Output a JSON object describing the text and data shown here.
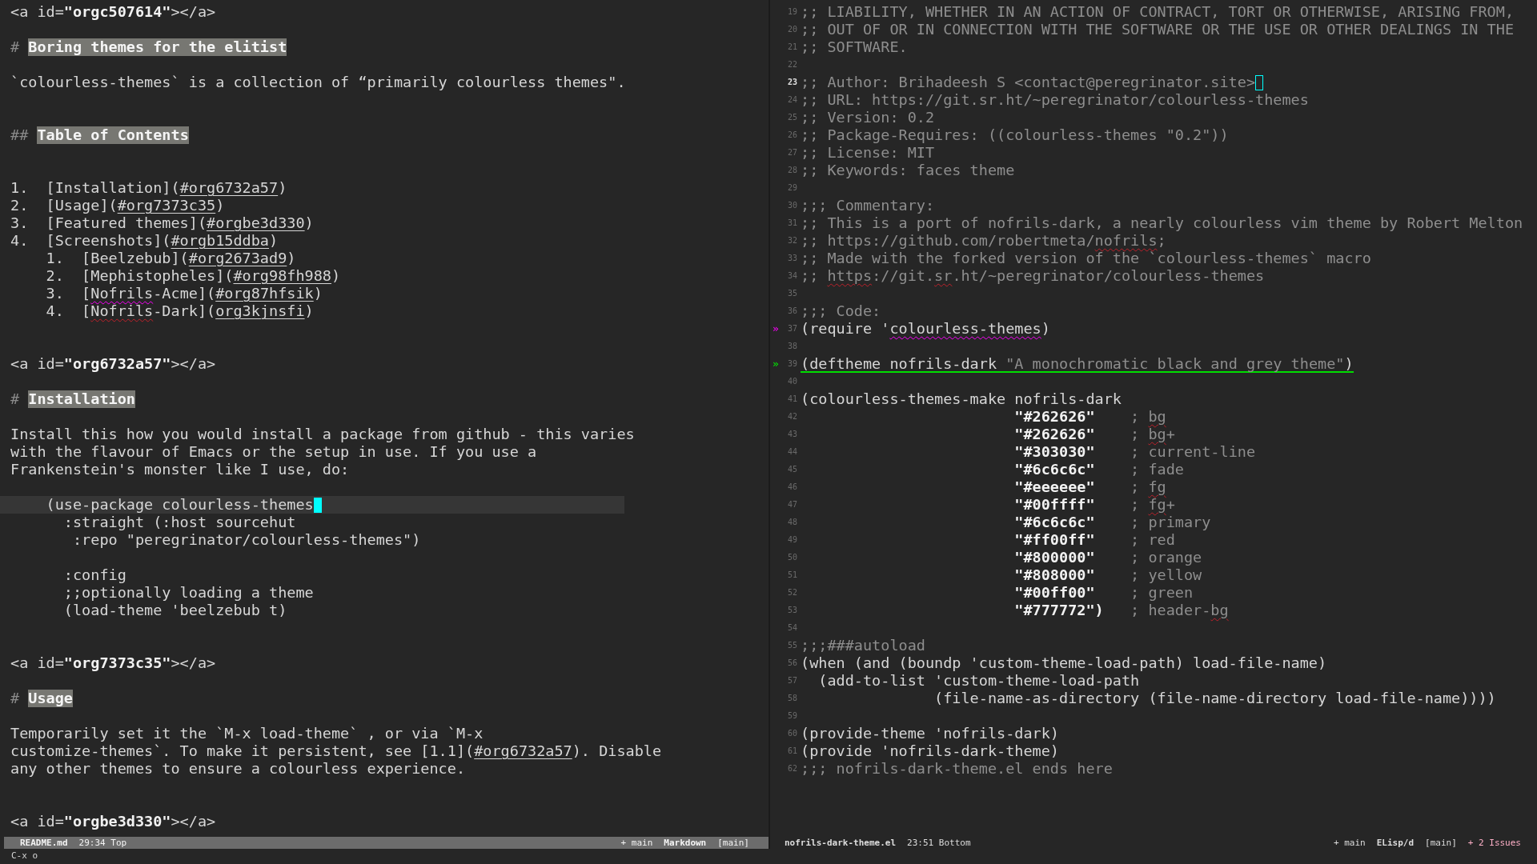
{
  "left": {
    "lines": [
      {
        "current": false,
        "segs": [
          {
            "text": "<a id=",
            "kind": "plain"
          },
          {
            "text": "\"orgc507614\"",
            "kind": "bold"
          },
          {
            "text": "></a>",
            "kind": "plain"
          }
        ]
      },
      {
        "current": false
      },
      {
        "current": false,
        "segs": [
          {
            "text": "# ",
            "kind": "mark"
          },
          {
            "text": "Boring themes for the elitist",
            "kind": "heading"
          }
        ]
      },
      {
        "current": false
      },
      {
        "current": false,
        "segs": [
          {
            "text": "`colourless-themes` is a collection of “primarily colourless themes\".",
            "kind": "plain"
          }
        ]
      },
      {
        "current": false
      },
      {
        "current": false
      },
      {
        "current": false,
        "segs": [
          {
            "text": "## ",
            "kind": "mark"
          },
          {
            "text": "Table of Contents",
            "kind": "heading"
          }
        ]
      },
      {
        "current": false
      },
      {
        "current": false
      },
      {
        "current": false,
        "segs": [
          {
            "text": "1.  [Installation](",
            "kind": "plain"
          },
          {
            "text": "#org6732a57",
            "kind": "link"
          },
          {
            "text": ")",
            "kind": "plain"
          }
        ]
      },
      {
        "current": false,
        "segs": [
          {
            "text": "2.  [Usage](",
            "kind": "plain"
          },
          {
            "text": "#org7373c35",
            "kind": "link"
          },
          {
            "text": ")",
            "kind": "plain"
          }
        ]
      },
      {
        "current": false,
        "segs": [
          {
            "text": "3.  [Featured themes](",
            "kind": "plain"
          },
          {
            "text": "#orgbe3d330",
            "kind": "link"
          },
          {
            "text": ")",
            "kind": "plain"
          }
        ]
      },
      {
        "current": false,
        "segs": [
          {
            "text": "4.  [Screenshots](",
            "kind": "plain"
          },
          {
            "text": "#orgb15ddba",
            "kind": "link"
          },
          {
            "text": ")",
            "kind": "plain"
          }
        ]
      },
      {
        "current": false,
        "segs": [
          {
            "text": "    1.  [Beelzebub](",
            "kind": "plain"
          },
          {
            "text": "#org2673ad9",
            "kind": "link"
          },
          {
            "text": ")",
            "kind": "plain"
          }
        ]
      },
      {
        "current": false,
        "segs": [
          {
            "text": "    2.  [Mephistopheles](",
            "kind": "plain"
          },
          {
            "text": "#org98fh988",
            "kind": "link"
          },
          {
            "text": ")",
            "kind": "plain"
          }
        ]
      },
      {
        "current": false,
        "segs": [
          {
            "text": "    3.  [",
            "kind": "plain"
          },
          {
            "text": "Nofrils",
            "kind": "plain",
            "flagged": true
          },
          {
            "text": "-Acme](",
            "kind": "plain"
          },
          {
            "text": "#org87hfsik",
            "kind": "link"
          },
          {
            "text": ")",
            "kind": "plain"
          }
        ]
      },
      {
        "current": false,
        "segs": [
          {
            "text": "    4.  [",
            "kind": "plain"
          },
          {
            "text": "Nofrils",
            "kind": "plain",
            "misspelled": true
          },
          {
            "text": "-Dark](",
            "kind": "plain"
          },
          {
            "text": "org3kjnsfi",
            "kind": "link"
          },
          {
            "text": ")",
            "kind": "plain"
          }
        ]
      },
      {
        "current": false
      },
      {
        "current": false
      },
      {
        "current": false,
        "segs": [
          {
            "text": "<a id=",
            "kind": "plain"
          },
          {
            "text": "\"org6732a57\"",
            "kind": "bold"
          },
          {
            "text": "></a>",
            "kind": "plain"
          }
        ]
      },
      {
        "current": false
      },
      {
        "current": false,
        "segs": [
          {
            "text": "# ",
            "kind": "mark"
          },
          {
            "text": "Installation",
            "kind": "heading"
          }
        ]
      },
      {
        "current": false
      },
      {
        "current": false,
        "segs": [
          {
            "text": "Install this how you would install a package from github - this varies",
            "kind": "plain"
          }
        ]
      },
      {
        "current": false,
        "segs": [
          {
            "text": "with the flavour of Emacs or the setup in use. If you use a",
            "kind": "plain"
          }
        ]
      },
      {
        "current": false,
        "segs": [
          {
            "text": "Frankenstein's monster like I use, do:",
            "kind": "plain"
          }
        ]
      },
      {
        "current": false
      },
      {
        "current": true,
        "cursor": true,
        "segs": [
          {
            "text": "    (use-package colourless-themes",
            "kind": "plain"
          }
        ]
      },
      {
        "current": false,
        "segs": [
          {
            "text": "      :straight (:host sourcehut",
            "kind": "plain"
          }
        ]
      },
      {
        "current": false,
        "segs": [
          {
            "text": "       :repo \"peregrinator/colourless-themes\")",
            "kind": "plain"
          }
        ]
      },
      {
        "current": false
      },
      {
        "current": false,
        "segs": [
          {
            "text": "      :config",
            "kind": "plain"
          }
        ]
      },
      {
        "current": false,
        "segs": [
          {
            "text": "      ;;optionally loading a theme",
            "kind": "plain"
          }
        ]
      },
      {
        "current": false,
        "segs": [
          {
            "text": "      (load-theme 'beelzebub t)",
            "kind": "plain"
          }
        ]
      },
      {
        "current": false
      },
      {
        "current": false
      },
      {
        "current": false,
        "segs": [
          {
            "text": "<a id=",
            "kind": "plain"
          },
          {
            "text": "\"org7373c35\"",
            "kind": "bold"
          },
          {
            "text": "></a>",
            "kind": "plain"
          }
        ]
      },
      {
        "current": false
      },
      {
        "current": false,
        "segs": [
          {
            "text": "# ",
            "kind": "mark"
          },
          {
            "text": "Usage",
            "kind": "heading"
          }
        ]
      },
      {
        "current": false
      },
      {
        "current": false,
        "segs": [
          {
            "text": "Temporarily set it the `M-x load-theme` , or via `M-x",
            "kind": "plain"
          }
        ]
      },
      {
        "current": false,
        "segs": [
          {
            "text": "customize-themes`. To make it persistent, see [1.1](",
            "kind": "plain"
          },
          {
            "text": "#org6732a57",
            "kind": "link"
          },
          {
            "text": "). Disable",
            "kind": "plain"
          }
        ]
      },
      {
        "current": false,
        "segs": [
          {
            "text": "any other themes to ensure a colourless experience.",
            "kind": "plain"
          }
        ]
      },
      {
        "current": false
      },
      {
        "current": false
      },
      {
        "current": false,
        "segs": [
          {
            "text": "<a id=",
            "kind": "plain"
          },
          {
            "text": "\"orgbe3d330\"",
            "kind": "bold"
          },
          {
            "text": "></a>",
            "kind": "plain"
          }
        ]
      }
    ],
    "mode_line": {
      "active": true,
      "left": [
        {
          "text": "README.md",
          "kind": "bold"
        },
        {
          "text": "29:34 Top",
          "kind": "plain"
        }
      ],
      "right": [
        {
          "text": "+ main",
          "kind": "plain"
        },
        {
          "text": "Markdown",
          "kind": "bold"
        },
        {
          "text": "[main]",
          "kind": "plain"
        }
      ]
    }
  },
  "right": {
    "lines": [
      {
        "number": "19",
        "current": false,
        "segs": [
          {
            "text": ";; LIABILITY, WHETHER IN AN ACTION OF CONTRACT, TORT OR OTHERWISE, ARISING FROM,",
            "kind": "comment"
          }
        ]
      },
      {
        "number": "20",
        "current": false,
        "segs": [
          {
            "text": ";; OUT OF OR IN CONNECTION WITH THE SOFTWARE OR THE USE OR OTHER DEALINGS IN THE",
            "kind": "comment"
          }
        ]
      },
      {
        "number": "21",
        "current": false,
        "segs": [
          {
            "text": ";; SOFTWARE.",
            "kind": "comment"
          }
        ]
      },
      {
        "number": "22",
        "current": false
      },
      {
        "number": "23",
        "current": true,
        "cursor": true,
        "segs": [
          {
            "text": ";; Author: Brihadeesh S <contact@peregrinator.site>",
            "kind": "comment"
          }
        ]
      },
      {
        "number": "24",
        "current": false,
        "segs": [
          {
            "text": ";; URL: https://git.sr.ht/~peregrinator/colourless-themes",
            "kind": "comment"
          }
        ]
      },
      {
        "number": "25",
        "current": false,
        "segs": [
          {
            "text": ";; Version: 0.2",
            "kind": "comment"
          }
        ]
      },
      {
        "number": "26",
        "current": false,
        "segs": [
          {
            "text": ";; Package-Requires: ((colourless-themes \"0.2\"))",
            "kind": "comment"
          }
        ]
      },
      {
        "number": "27",
        "current": false,
        "segs": [
          {
            "text": ";; License: MIT",
            "kind": "comment"
          }
        ]
      },
      {
        "number": "28",
        "current": false,
        "segs": [
          {
            "text": ";; Keywords: faces theme",
            "kind": "comment"
          }
        ]
      },
      {
        "number": "29",
        "current": false
      },
      {
        "number": "30",
        "current": false,
        "segs": [
          {
            "text": ";;; Commentary:",
            "kind": "comment"
          }
        ]
      },
      {
        "number": "31",
        "current": false,
        "segs": [
          {
            "text": ";; This is a port of nofrils-dark, a nearly colourless vim theme by Robert Melton",
            "kind": "comment"
          }
        ]
      },
      {
        "number": "32",
        "current": false,
        "segs": [
          {
            "text": ";; https://github.com/robertmeta/",
            "kind": "comment"
          },
          {
            "text": "nofrils",
            "kind": "comment",
            "misspelled": true
          },
          {
            "text": ";",
            "kind": "comment"
          }
        ]
      },
      {
        "number": "33",
        "current": false,
        "segs": [
          {
            "text": ";; Made with the forked version of the `colourless-themes` macro",
            "kind": "comment"
          }
        ]
      },
      {
        "number": "34",
        "current": false,
        "segs": [
          {
            "text": ";; ",
            "kind": "comment"
          },
          {
            "text": "https",
            "kind": "comment",
            "misspelled": true
          },
          {
            "text": "://git.",
            "kind": "comment"
          },
          {
            "text": "sr",
            "kind": "comment",
            "misspelled": true
          },
          {
            "text": ".ht/~peregrinator/colourless-themes",
            "kind": "comment"
          }
        ]
      },
      {
        "number": "35",
        "current": false
      },
      {
        "number": "36",
        "current": false,
        "segs": [
          {
            "text": ";;; Code:",
            "kind": "comment"
          }
        ]
      },
      {
        "number": "37",
        "current": false,
        "fringe": {
          "text": "»",
          "kind": "warn"
        },
        "segs": [
          {
            "text": "(require '",
            "kind": "plain"
          },
          {
            "text": "colourless-themes",
            "kind": "plain",
            "flagged": true
          },
          {
            "text": ")",
            "kind": "plain"
          }
        ]
      },
      {
        "number": "38",
        "current": false
      },
      {
        "number": "39",
        "current": false,
        "fringe": {
          "text": "»",
          "kind": "ok"
        },
        "checked_ok": true,
        "segs": [
          {
            "text": "(deftheme nofrils-dark ",
            "kind": "plain"
          },
          {
            "text": "\"A monochromatic black and grey theme\"",
            "kind": "comment"
          },
          {
            "text": ")",
            "kind": "plain"
          }
        ]
      },
      {
        "number": "40",
        "current": false
      },
      {
        "number": "41",
        "current": false,
        "segs": [
          {
            "text": "(colourless-themes-make nofrils-dark",
            "kind": "plain"
          }
        ]
      },
      {
        "number": "42",
        "current": false,
        "segs": [
          {
            "text": "                        \"#262626\"    ",
            "kind": "bold"
          },
          {
            "text": "; ",
            "kind": "comment"
          },
          {
            "text": "bg",
            "kind": "comment",
            "misspelled": true
          }
        ]
      },
      {
        "number": "43",
        "current": false,
        "segs": [
          {
            "text": "                        \"#262626\"    ",
            "kind": "bold"
          },
          {
            "text": "; ",
            "kind": "comment"
          },
          {
            "text": "bg",
            "kind": "comment",
            "misspelled": true
          },
          {
            "text": "+",
            "kind": "comment"
          }
        ]
      },
      {
        "number": "44",
        "current": false,
        "segs": [
          {
            "text": "                        \"#303030\"    ",
            "kind": "bold"
          },
          {
            "text": "; current-line",
            "kind": "comment"
          }
        ]
      },
      {
        "number": "45",
        "current": false,
        "segs": [
          {
            "text": "                        \"#6c6c6c\"    ",
            "kind": "bold"
          },
          {
            "text": "; fade",
            "kind": "comment"
          }
        ]
      },
      {
        "number": "46",
        "current": false,
        "segs": [
          {
            "text": "                        \"#eeeeee\"    ",
            "kind": "bold"
          },
          {
            "text": "; ",
            "kind": "comment"
          },
          {
            "text": "fg",
            "kind": "comment",
            "misspelled": true
          }
        ]
      },
      {
        "number": "47",
        "current": false,
        "segs": [
          {
            "text": "                        \"#00ffff\"    ",
            "kind": "bold"
          },
          {
            "text": "; ",
            "kind": "comment"
          },
          {
            "text": "fg",
            "kind": "comment",
            "misspelled": true
          },
          {
            "text": "+",
            "kind": "comment"
          }
        ]
      },
      {
        "number": "48",
        "current": false,
        "segs": [
          {
            "text": "                        \"#6c6c6c\"    ",
            "kind": "bold"
          },
          {
            "text": "; primary",
            "kind": "comment"
          }
        ]
      },
      {
        "number": "49",
        "current": false,
        "segs": [
          {
            "text": "                        \"#ff00ff\"    ",
            "kind": "bold"
          },
          {
            "text": "; red",
            "kind": "comment"
          }
        ]
      },
      {
        "number": "50",
        "current": false,
        "segs": [
          {
            "text": "                        \"#800000\"    ",
            "kind": "bold"
          },
          {
            "text": "; orange",
            "kind": "comment"
          }
        ]
      },
      {
        "number": "51",
        "current": false,
        "segs": [
          {
            "text": "                        \"#808000\"    ",
            "kind": "bold"
          },
          {
            "text": "; yellow",
            "kind": "comment"
          }
        ]
      },
      {
        "number": "52",
        "current": false,
        "segs": [
          {
            "text": "                        \"#00ff00\"    ",
            "kind": "bold"
          },
          {
            "text": "; green",
            "kind": "comment"
          }
        ]
      },
      {
        "number": "53",
        "current": false,
        "segs": [
          {
            "text": "                        \"#777772\")   ",
            "kind": "bold"
          },
          {
            "text": "; header-",
            "kind": "comment"
          },
          {
            "text": "bg",
            "kind": "comment",
            "misspelled": true
          }
        ]
      },
      {
        "number": "54",
        "current": false
      },
      {
        "number": "55",
        "current": false,
        "segs": [
          {
            "text": ";;;###autoload",
            "kind": "comment"
          }
        ]
      },
      {
        "number": "56",
        "current": false,
        "segs": [
          {
            "text": "(when (and (boundp 'custom-theme-load-path) load-file-name)",
            "kind": "plain"
          }
        ]
      },
      {
        "number": "57",
        "current": false,
        "segs": [
          {
            "text": "  (add-to-list 'custom-theme-load-path",
            "kind": "plain"
          }
        ]
      },
      {
        "number": "58",
        "current": false,
        "segs": [
          {
            "text": "               (file-name-as-directory (file-name-directory load-file-name))))",
            "kind": "plain"
          }
        ]
      },
      {
        "number": "59",
        "current": false
      },
      {
        "number": "60",
        "current": false,
        "segs": [
          {
            "text": "(provide-theme 'nofrils-dark)",
            "kind": "plain"
          }
        ]
      },
      {
        "number": "61",
        "current": false,
        "segs": [
          {
            "text": "(provide 'nofrils-dark-theme)",
            "kind": "plain"
          }
        ]
      },
      {
        "number": "62",
        "current": false,
        "segs": [
          {
            "text": ";;; nofrils-dark-theme.el ends here",
            "kind": "comment"
          }
        ]
      }
    ],
    "mode_line": {
      "active": false,
      "left": [
        {
          "text": "nofrils-dark-theme.el",
          "kind": "bold"
        },
        {
          "text": "23:51 Bottom",
          "kind": "plain"
        }
      ],
      "right": [
        {
          "text": "+ main",
          "kind": "plain"
        },
        {
          "text": "ELisp/d",
          "kind": "bold"
        },
        {
          "text": "[main]",
          "kind": "plain"
        },
        {
          "text": "+ 2 Issues",
          "kind": "warn"
        }
      ]
    }
  },
  "echo_area": "C-x o"
}
